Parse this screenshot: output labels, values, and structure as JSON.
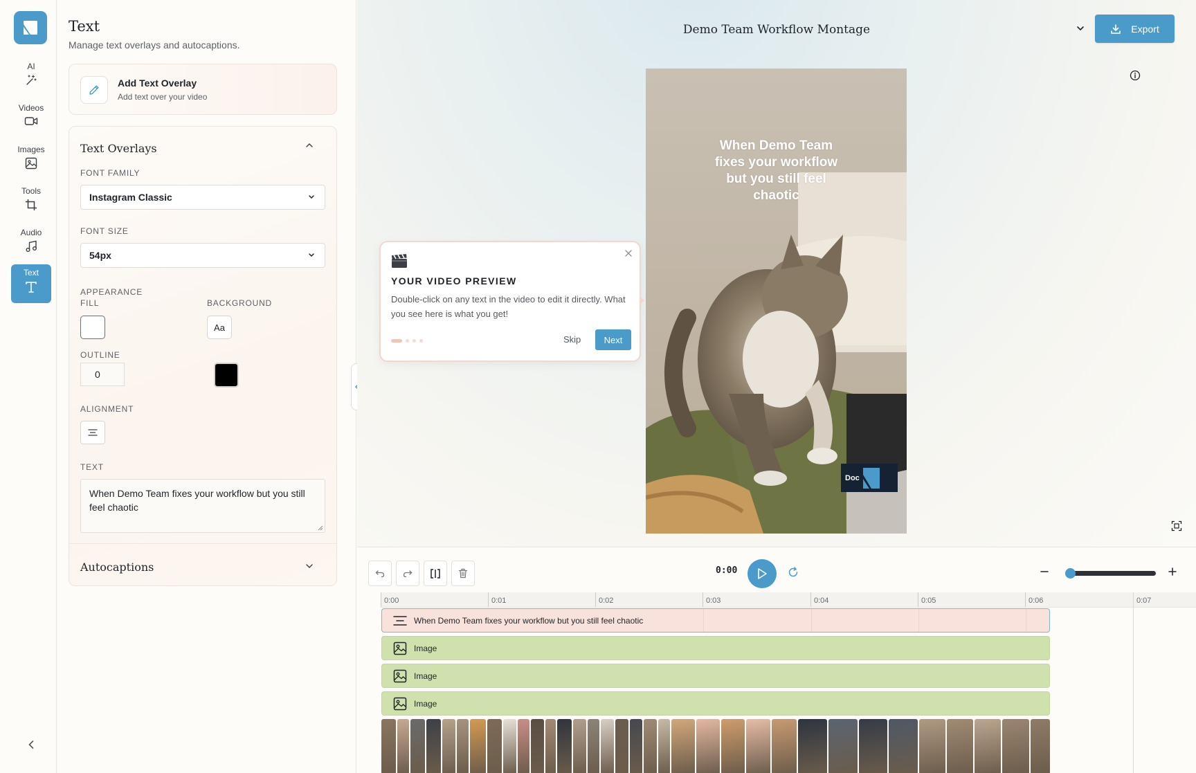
{
  "rail": {
    "items": [
      {
        "label": "AI",
        "icon": "magic-wand-icon"
      },
      {
        "label": "Videos",
        "icon": "video-camera-icon"
      },
      {
        "label": "Images",
        "icon": "image-icon"
      },
      {
        "label": "Tools",
        "icon": "crop-icon"
      },
      {
        "label": "Audio",
        "icon": "music-note-icon"
      },
      {
        "label": "Text",
        "icon": "text-icon",
        "active": true
      }
    ]
  },
  "panel": {
    "title": "Text",
    "subtitle": "Manage text overlays and autocaptions.",
    "add_overlay": {
      "title": "Add Text Overlay",
      "subtitle": "Add text over your video"
    },
    "overlays": {
      "title": "Text Overlays",
      "font_family_label": "FONT FAMILY",
      "font_family_value": "Instagram Classic",
      "font_size_label": "FONT SIZE",
      "font_size_value": "54px",
      "appearance_label": "APPEARANCE",
      "fill_label": "FILL",
      "background_label": "BACKGROUND",
      "background_button": "Aa",
      "outline_label": "OUTLINE",
      "outline_value": "0",
      "outline_color": "#000000",
      "alignment_label": "ALIGNMENT",
      "text_label": "TEXT",
      "text_value": "When Demo Team fixes your workflow but you still feel chaotic"
    },
    "autocaptions_title": "Autocaptions"
  },
  "header": {
    "project_title": "Demo Team Workflow Montage",
    "export_label": "Export"
  },
  "preview": {
    "overlay_text": "When Demo Team fixes your workflow but you still feel chaotic",
    "watermark_text": "Doc"
  },
  "tour": {
    "title": "YOUR VIDEO PREVIEW",
    "body": "Double-click on any text in the video to edit it directly. What you see here is what you get!",
    "skip_label": "Skip",
    "next_label": "Next",
    "step": 1,
    "steps": 4
  },
  "timeline": {
    "current_time": "0:00",
    "ticks": [
      "0:00",
      "0:01",
      "0:02",
      "0:03",
      "0:04",
      "0:05",
      "0:06",
      "0:07"
    ],
    "tracks": [
      {
        "type": "text",
        "label": "When Demo Team fixes your workflow but you still feel chaotic"
      },
      {
        "type": "image",
        "label": "Image"
      },
      {
        "type": "image",
        "label": "Image"
      },
      {
        "type": "image",
        "label": "Image"
      }
    ]
  },
  "colors": {
    "accent": "#4a9bc9",
    "text_track": "#f9e2dc",
    "image_track": "#cfe2ae"
  }
}
